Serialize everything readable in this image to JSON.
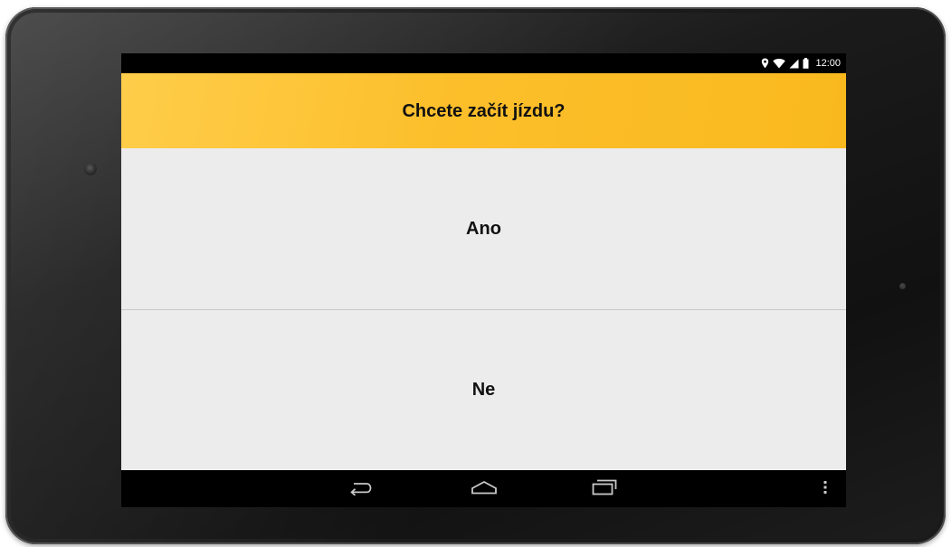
{
  "status_bar": {
    "time": "12:00",
    "icons": [
      "location-icon",
      "wifi-icon",
      "cell-signal-icon",
      "battery-icon"
    ]
  },
  "header": {
    "title": "Chcete začít jízdu?",
    "background_color": "#fcbf2b"
  },
  "options": [
    {
      "label": "Ano"
    },
    {
      "label": "Ne"
    }
  ],
  "nav_bar": {
    "buttons": [
      "back-icon",
      "home-icon",
      "recents-icon",
      "overflow-menu-icon"
    ]
  },
  "colors": {
    "accent": "#fcbf2b",
    "options_background": "#ececec",
    "divider": "#c8c8c8"
  }
}
